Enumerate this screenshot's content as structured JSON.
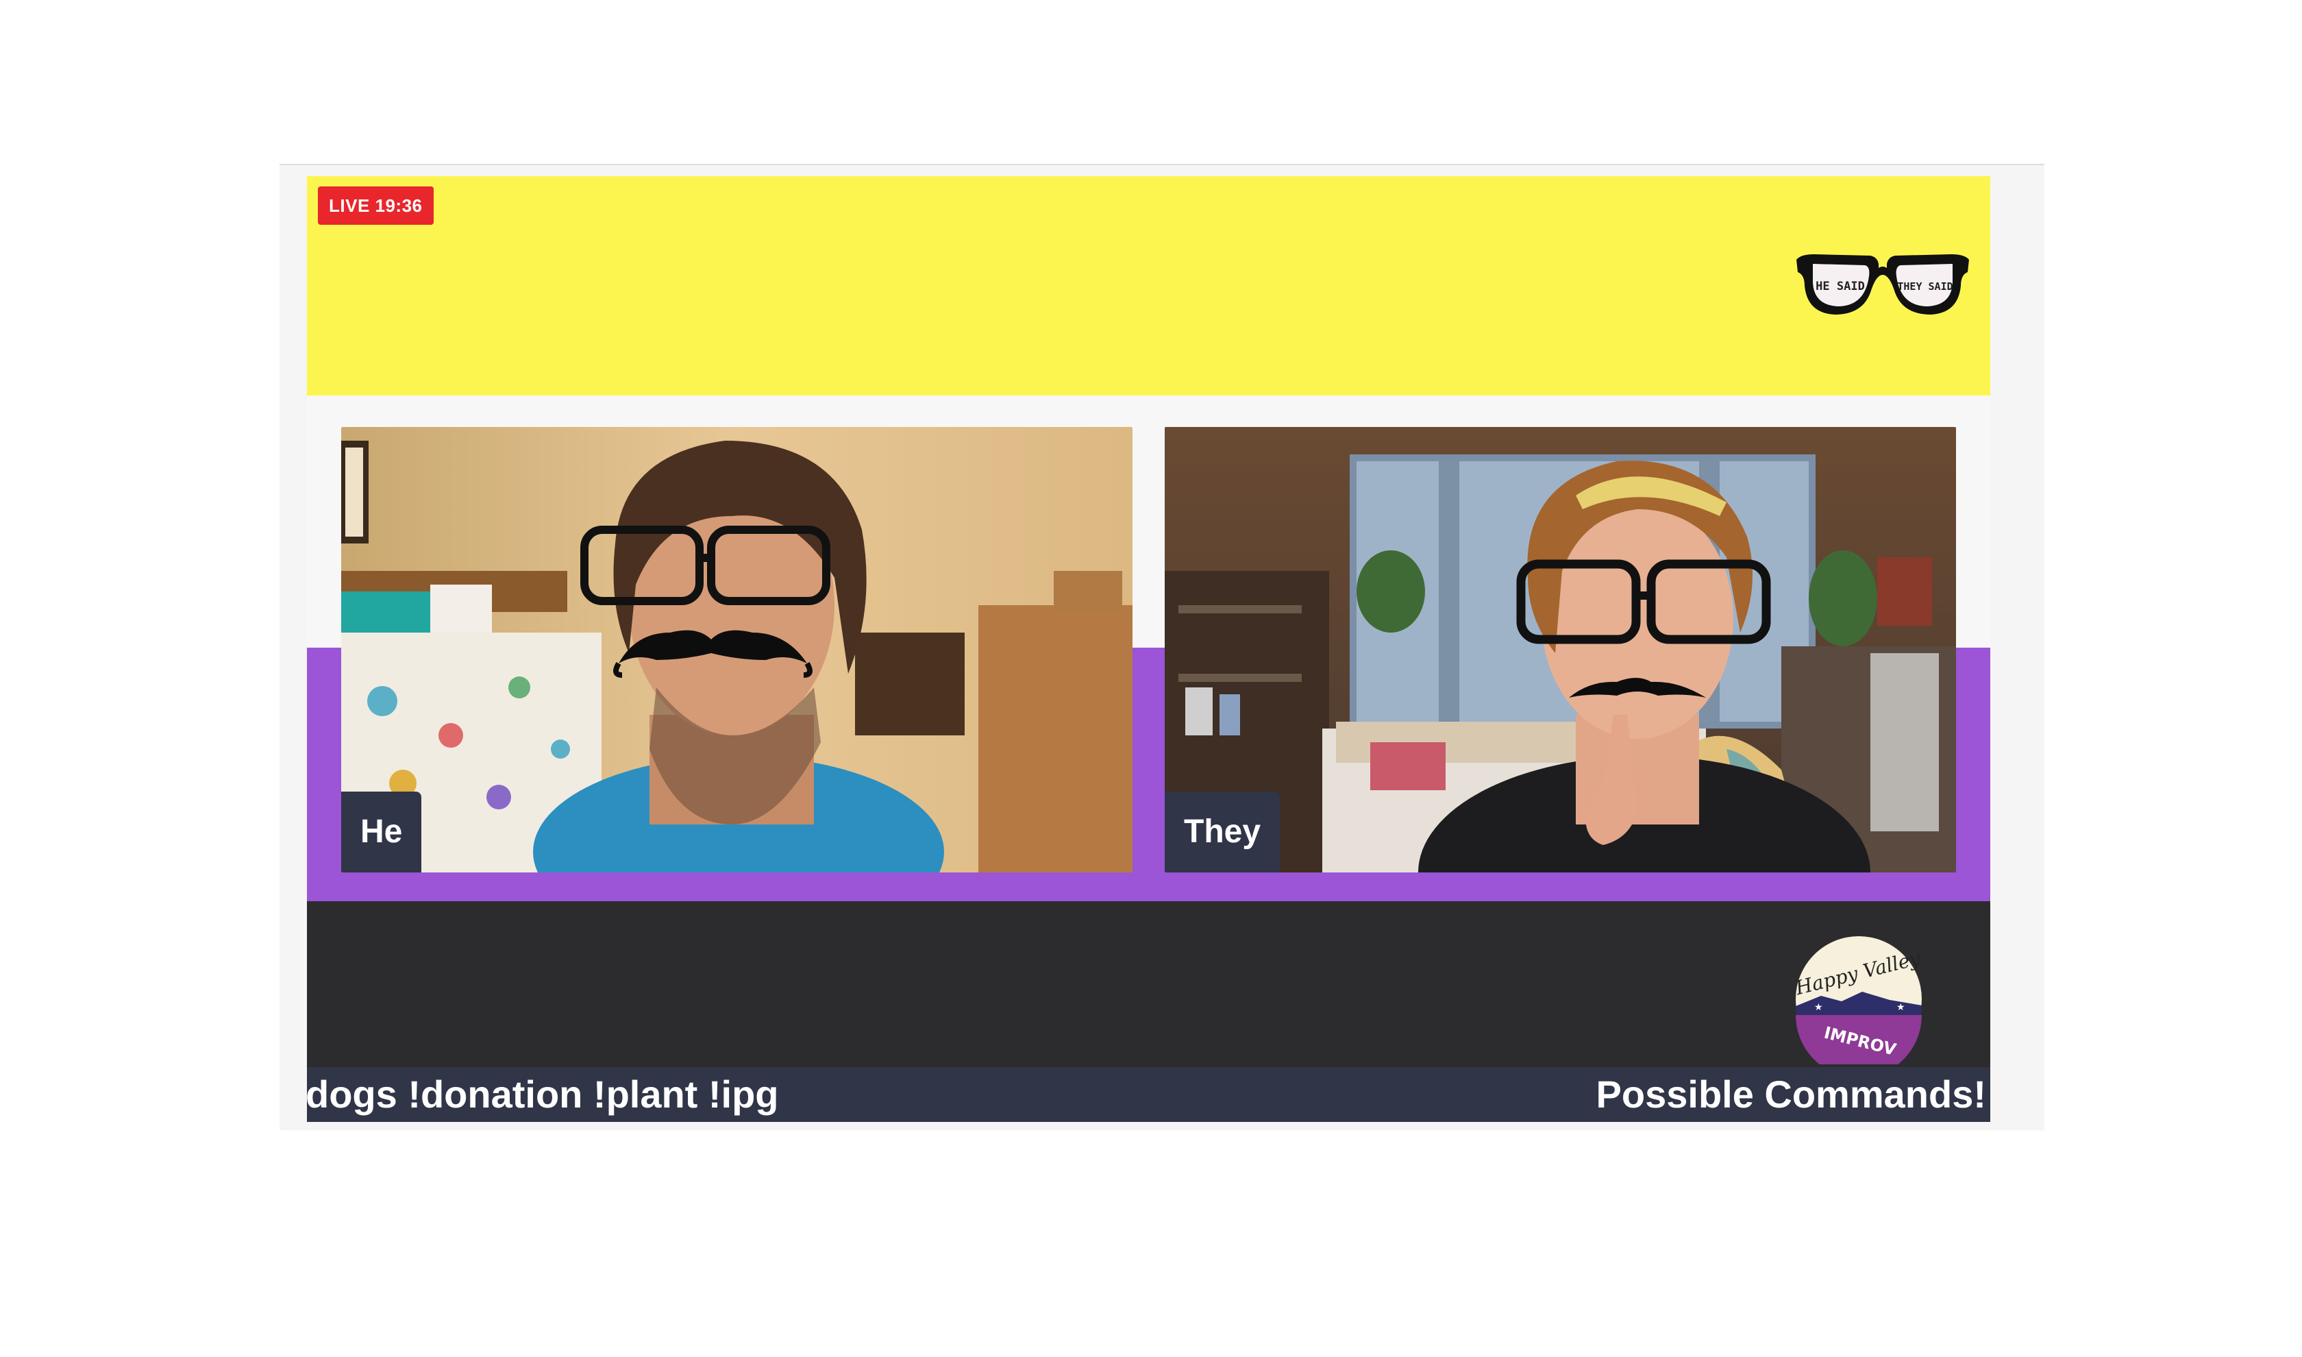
{
  "broadcast": {
    "live_label": "LIVE 19:36"
  },
  "banner": {
    "logo_icon": "glasses-logo-icon",
    "logo_left_lens_text": "HE SAID",
    "logo_right_lens_text": "THEY SAID"
  },
  "participants": [
    {
      "name": "He"
    },
    {
      "name": "They"
    }
  ],
  "sponsor_logo": {
    "top_text": "Happy Valley",
    "bottom_text": "IMPROV"
  },
  "ticker": {
    "scrolling_text": "dogs !donation !plant !ipg",
    "commands_label": "Possible Commands!"
  },
  "colors": {
    "top_banner": "#fdf54f",
    "purple_band": "#9b55d6",
    "dark_band": "#2c2c2e",
    "ticker_bar": "#303548",
    "live_badge": "#e8262b"
  }
}
